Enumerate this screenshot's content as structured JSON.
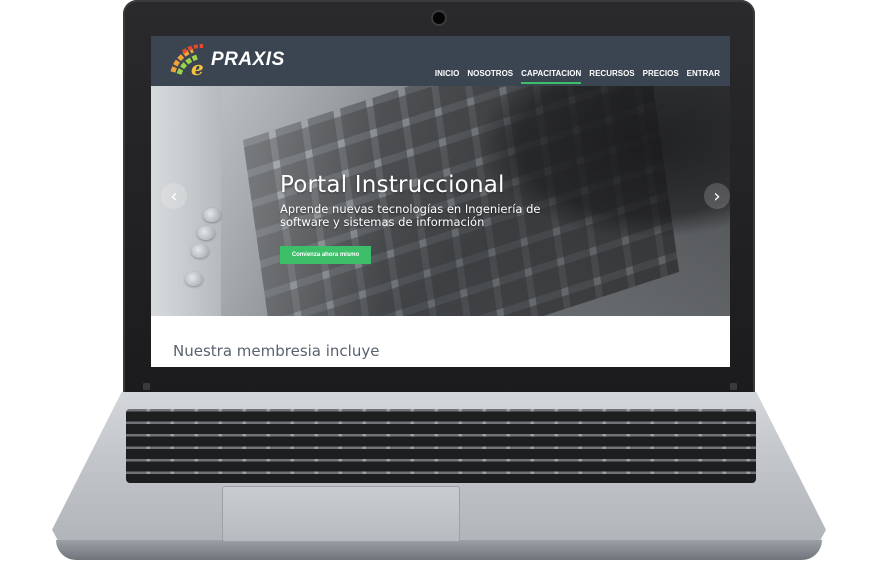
{
  "site": {
    "logo_text": "PRAXIS",
    "brand_colors": {
      "nav_bg": "#3b4451",
      "accent_green": "#3dbf6a"
    }
  },
  "nav": {
    "items": [
      {
        "label": "INICIO"
      },
      {
        "label": "NOSOTROS"
      },
      {
        "label": "CAPACITACION",
        "active": true
      },
      {
        "label": "RECURSOS"
      },
      {
        "label": "PRECIOS"
      },
      {
        "label": "ENTRAR"
      }
    ]
  },
  "hero": {
    "title": "Portal Instruccional",
    "subtitle": "Aprende nuevas tecnologías en Ingeniería de software y sistemas de información",
    "cta_label": "Comienza ahora mismo",
    "prev_icon": "‹",
    "next_icon": "›"
  },
  "section": {
    "title": "Nuestra membresia incluye"
  }
}
